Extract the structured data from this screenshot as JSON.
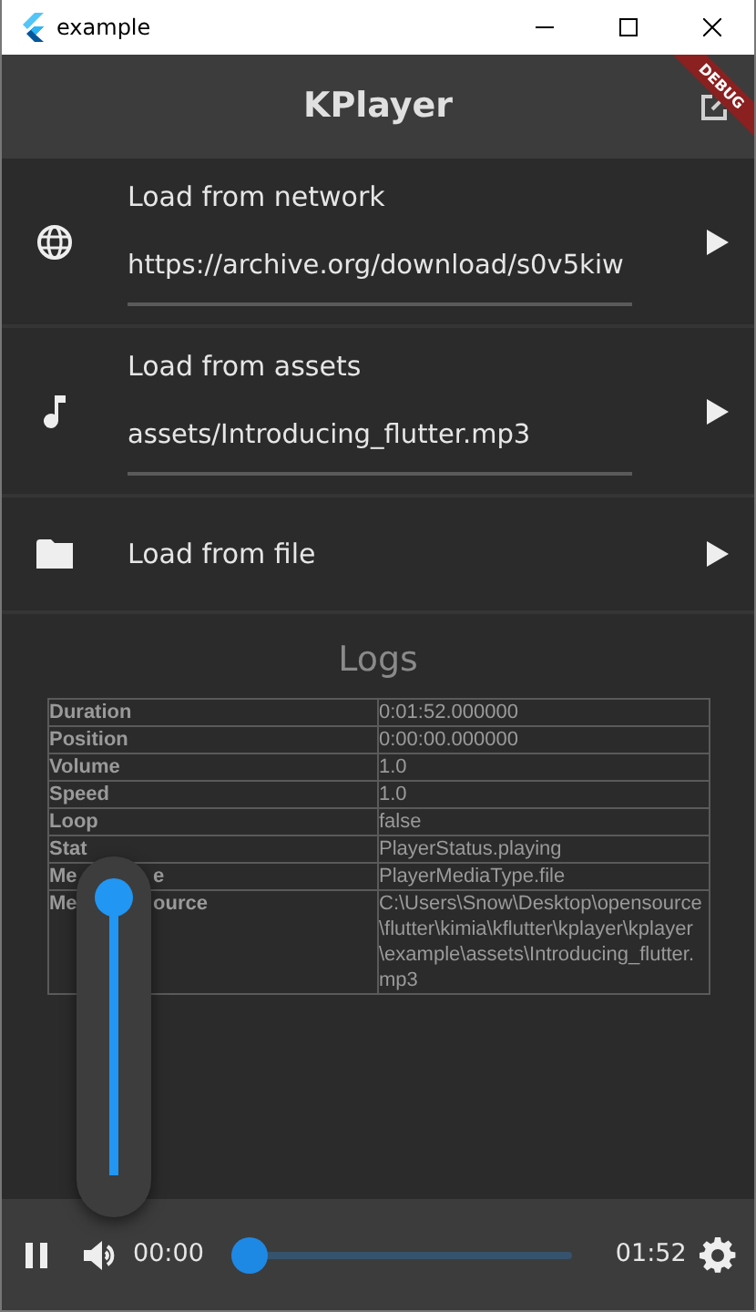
{
  "window": {
    "title": "example"
  },
  "app_bar": {
    "title": "KPlayer",
    "banner": "DEBUG"
  },
  "sources": [
    {
      "kind": "network",
      "title": "Load from network",
      "value": "https://archive.org/download/s0v5kiw"
    },
    {
      "kind": "assets",
      "title": "Load from assets",
      "value": "assets/Introducing_flutter.mp3"
    },
    {
      "kind": "file",
      "title": "Load from file"
    }
  ],
  "logs": {
    "title": "Logs",
    "rows": [
      {
        "label": [
          "Duration"
        ],
        "value": "0:01:52.000000"
      },
      {
        "label": [
          "Position"
        ],
        "value": "0:00:00.000000"
      },
      {
        "label": [
          "Volume"
        ],
        "value": "1.0"
      },
      {
        "label": [
          "Speed"
        ],
        "value": "1.0"
      },
      {
        "label": [
          "Loop"
        ],
        "value": "false"
      },
      {
        "label": [
          "Stat"
        ],
        "value": "PlayerStatus.playing"
      },
      {
        "label": [
          "Me",
          "e"
        ],
        "value": "PlayerMediaType.file"
      },
      {
        "label": [
          "Me",
          "ource"
        ],
        "value": "C:\\Users\\Snow\\Desktop\\opensource\\flutter\\kimia\\kflutter\\kplayer\\kplayer\\example\\assets\\Introducing_flutter.mp3"
      }
    ]
  },
  "volume_popup": {
    "level": 1
  },
  "player": {
    "playing": true,
    "position": "00:00",
    "duration": "01:52",
    "level": 0
  }
}
